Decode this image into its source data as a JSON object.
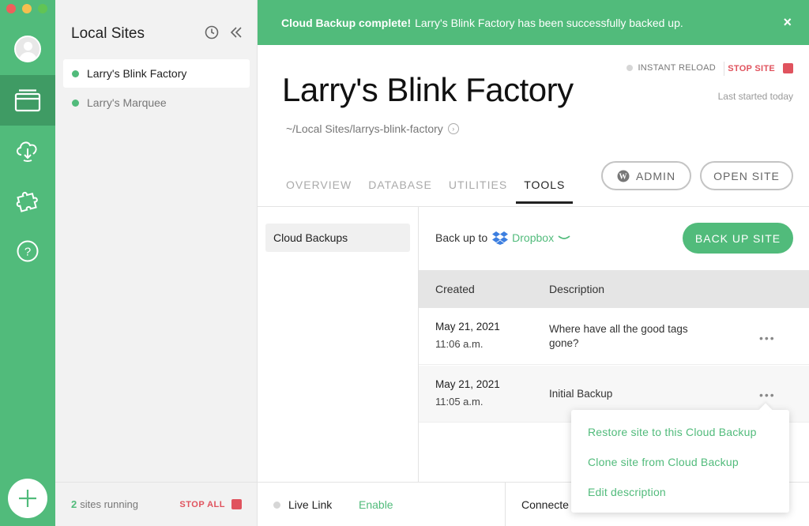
{
  "colors": {
    "accent": "#51bb7b",
    "accent_dark": "#3f9b64",
    "danger": "#e0535e"
  },
  "window": {
    "traffic_lights": [
      "#ee5f5b",
      "#f5bf4f",
      "#61c454"
    ]
  },
  "rail": {
    "icons": [
      "user-avatar-icon",
      "sites-icon",
      "cloud-sync-icon",
      "puzzle-addons-icon",
      "help-icon",
      "plus-icon"
    ]
  },
  "sites_panel": {
    "title": "Local Sites",
    "sites": [
      {
        "name": "Larry's Blink Factory",
        "active": true
      },
      {
        "name": "Larry's Marquee",
        "active": false
      }
    ],
    "footer": {
      "count": "2",
      "count_suffix": "sites running",
      "stop_all": "STOP ALL"
    }
  },
  "banner": {
    "bold": "Cloud Backup complete!",
    "text": "Larry's Blink Factory has been successfully backed up.",
    "close": "×"
  },
  "header": {
    "instant_reload": "INSTANT RELOAD",
    "stop_site": "STOP SITE",
    "last_started": "Last started today",
    "site_title": "Larry's Blink Factory",
    "site_path": "~/Local Sites/larrys-blink-factory"
  },
  "tabs": [
    {
      "label": "OVERVIEW",
      "active": false
    },
    {
      "label": "DATABASE",
      "active": false
    },
    {
      "label": "UTILITIES",
      "active": false
    },
    {
      "label": "TOOLS",
      "active": true
    }
  ],
  "actions": {
    "admin": "ADMIN",
    "open_site": "OPEN SITE"
  },
  "tools": {
    "items": [
      "Cloud Backups"
    ],
    "backup_to_label": "Back up to",
    "provider": "Dropbox",
    "back_up_button": "BACK UP SITE",
    "table": {
      "headers": {
        "created": "Created",
        "description": "Description"
      },
      "rows": [
        {
          "date": "May 21, 2021",
          "time": "11:06 a.m.",
          "description": "Where have all the good tags gone?",
          "more": "•••"
        },
        {
          "date": "May 21, 2021",
          "time": "11:05 a.m.",
          "description": "Initial Backup",
          "more": "•••"
        }
      ]
    },
    "menu": [
      "Restore site to this Cloud Backup",
      "Clone site from Cloud Backup",
      "Edit description"
    ]
  },
  "footer": {
    "live_link": "Live Link",
    "enable": "Enable",
    "connected": "Connecte"
  }
}
